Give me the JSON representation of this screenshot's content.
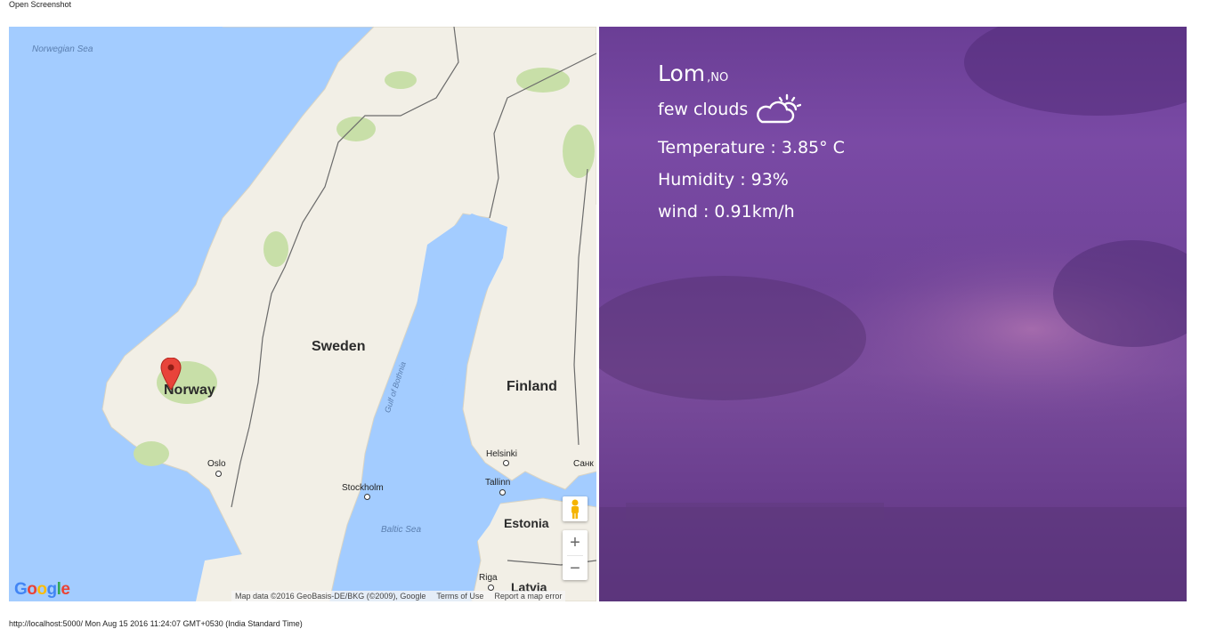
{
  "top_link": "Open Screenshot",
  "footer": "http://localhost:5000/ Mon Aug 15 2016 11:24:07 GMT+0530 (India Standard Time)",
  "map": {
    "countries": {
      "norway": "Norway",
      "sweden": "Sweden",
      "finland": "Finland",
      "estonia": "Estonia",
      "latvia": "Latvia"
    },
    "cities": {
      "oslo": "Oslo",
      "stockholm": "Stockholm",
      "helsinki": "Helsinki",
      "tallinn": "Tallinn",
      "riga": "Riga",
      "sank": "Санк"
    },
    "seas": {
      "norwegian": "Norwegian Sea",
      "baltic": "Baltic Sea",
      "gulf": "Gulf of Bothnia"
    },
    "zoom_in": "+",
    "zoom_out": "−",
    "logo": "Google",
    "attribution": {
      "data": "Map data ©2016 GeoBasis-DE/BKG (©2009), Google",
      "terms": "Terms of Use",
      "report": "Report a map error"
    },
    "colors": {
      "water": "#a3ccff",
      "land": "#f2efe6",
      "forest": "#c8dfa8",
      "marker": "#e8443a"
    }
  },
  "weather": {
    "city": "Lom",
    "country": ",NO",
    "description": "few clouds",
    "icon": "partly-cloudy-icon",
    "temperature": "Temperature : 3.85° C",
    "humidity": "Humidity : 93%",
    "wind": "wind : 0.91km/h",
    "colors": {
      "background": "#6f4398",
      "text": "#ffffff"
    }
  }
}
